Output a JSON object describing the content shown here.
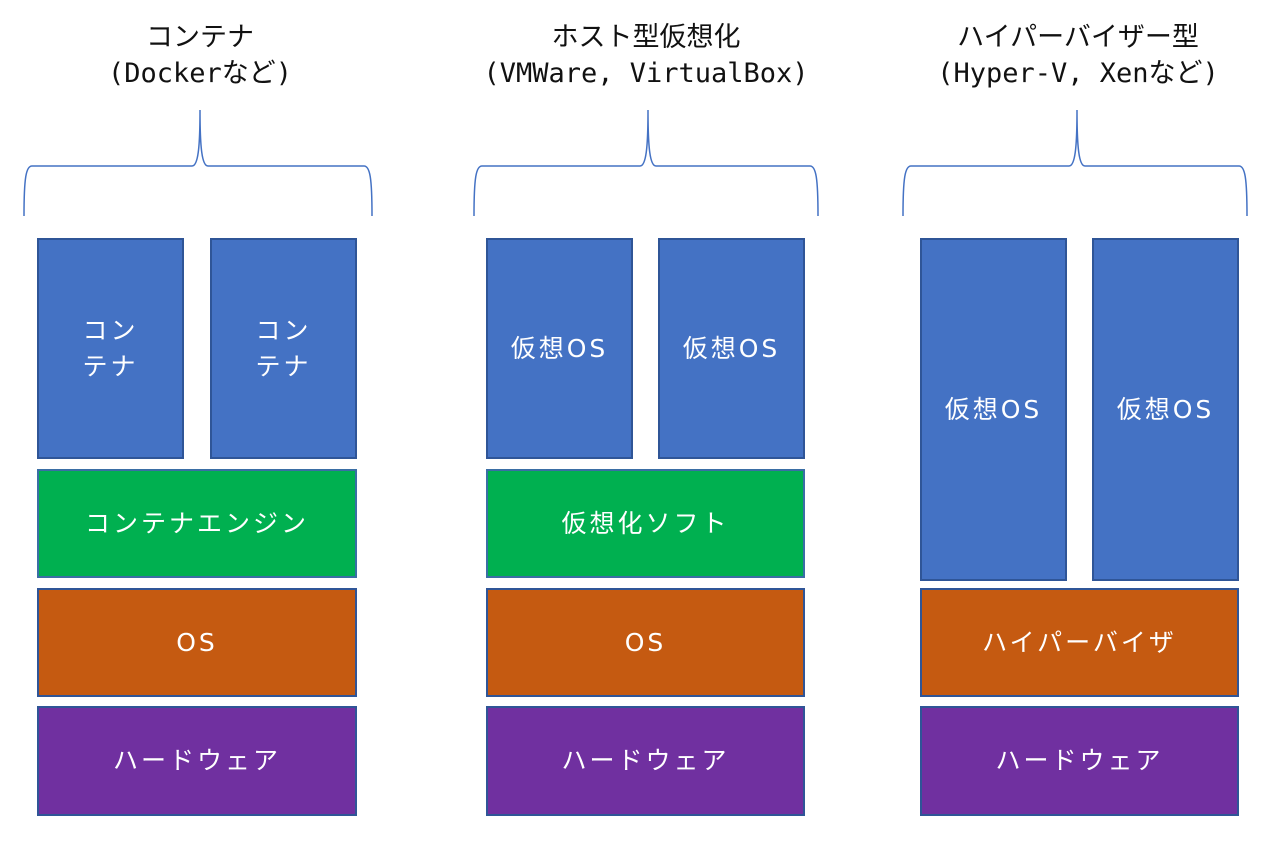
{
  "columns": [
    {
      "title": "コンテナ",
      "subtitle": "(Dockerなど)",
      "top_boxes": [
        "コン\nテナ",
        "コン\nテナ"
      ],
      "layers": [
        "コンテナエンジン",
        "OS",
        "ハードウェア"
      ]
    },
    {
      "title": "ホスト型仮想化",
      "subtitle": "(VMWare, VirtualBox)",
      "top_boxes": [
        "仮想OS",
        "仮想OS"
      ],
      "layers": [
        "仮想化ソフト",
        "OS",
        "ハードウェア"
      ]
    },
    {
      "title": "ハイパーバイザー型",
      "subtitle": "(Hyper-V, Xenなど)",
      "top_boxes": [
        "仮想OS",
        "仮想OS"
      ],
      "layers": [
        "ハイパーバイザ",
        "ハードウェア"
      ]
    }
  ],
  "colors": {
    "guest": "#4472c4",
    "middleware": "#00b050",
    "os": "#c55a11",
    "hardware": "#7030a0",
    "brace": "#4472c4"
  }
}
